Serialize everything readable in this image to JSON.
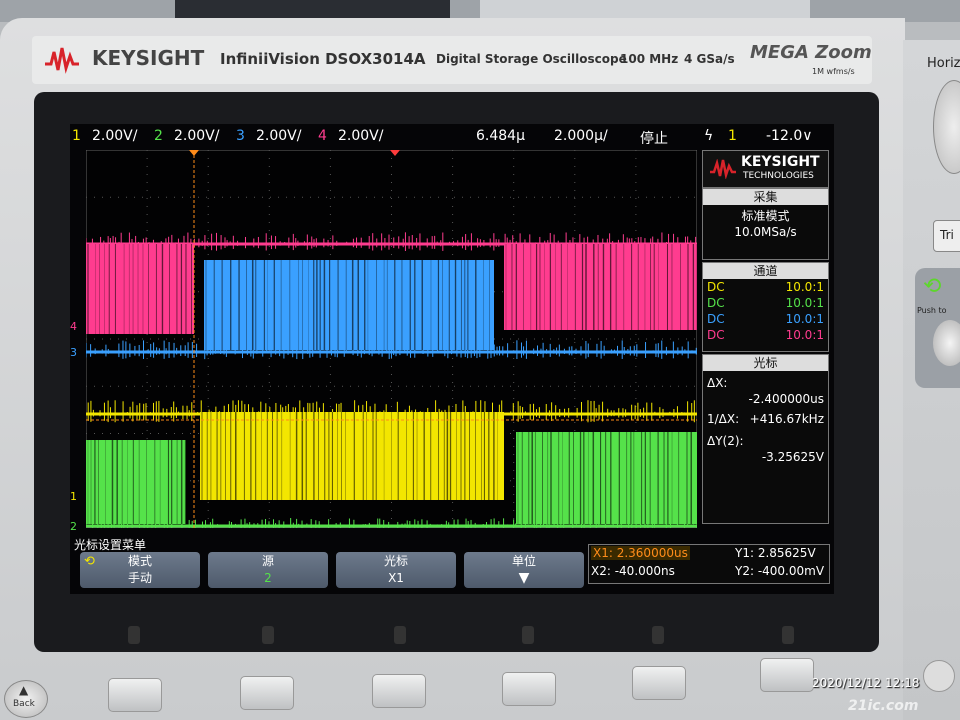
{
  "header": {
    "brand": "KEYSIGHT",
    "model": "InfiniiVision DSOX3014A",
    "description": "Digital Storage Oscilloscope",
    "bandwidth": "100 MHz",
    "sample_rate": "4 GSa/s",
    "mega_zoom": "MEGA Zoom",
    "mega_sub": "1M wfms/s"
  },
  "status_bar": {
    "ch1": "1",
    "ch1_scale": "2.00V/",
    "ch2": "2",
    "ch2_scale": "2.00V/",
    "ch3": "3",
    "ch3_scale": "2.00V/",
    "ch4": "4",
    "ch4_scale": "2.00V/",
    "delay": "6.484µ",
    "timebase": "2.000µ/",
    "run_state": "停止",
    "trig_symbol": "ϟ",
    "trig_channel": "1",
    "trig_level": "-12.0∨"
  },
  "sidebar": {
    "logo": "KEYSIGHT",
    "logo_sub": "TECHNOLOGIES",
    "acq_title": "采集",
    "acq_mode": "标准模式",
    "acq_rate": "10.0MSa/s",
    "ch_title": "通道",
    "channels": [
      {
        "coupling": "DC",
        "probe": "10.0:1",
        "color": "#f3e600"
      },
      {
        "coupling": "DC",
        "probe": "10.0:1",
        "color": "#55e24a"
      },
      {
        "coupling": "DC",
        "probe": "10.0:1",
        "color": "#3aa0ff"
      },
      {
        "coupling": "DC",
        "probe": "10.0:1",
        "color": "#ff3c8f"
      }
    ],
    "cursor_title": "光标",
    "dx_label": "ΔX:",
    "dx_value": "-2.400000us",
    "inv_dx_label": "1/ΔX:",
    "inv_dx_value": "+416.67kHz",
    "dy_label": "ΔY(2):",
    "dy_value": "-3.25625V"
  },
  "softkeys": {
    "menu_title": "光标设置菜单",
    "mode_label": "模式",
    "mode_value": "手动",
    "source_label": "源",
    "source_value": "2",
    "cursor_label": "光标",
    "cursor_value": "X1",
    "units_label": "单位"
  },
  "readout": {
    "x1": "X1: 2.360000us",
    "x2": "X2: -40.000ns",
    "y1": "Y1: 2.85625V",
    "y2": "Y2: -400.00mV"
  },
  "timestamp": "2020/12/12 12:18",
  "right_panel": {
    "horiz": "Horiz",
    "trig": "Tri",
    "push": "Push to"
  },
  "back_label": "Back",
  "watermark": "21ic.com",
  "colors": {
    "ch1": "#f3e600",
    "ch2": "#55e24a",
    "ch3": "#3aa0ff",
    "ch4": "#ff3c8f",
    "brand_red": "#d8232a"
  }
}
